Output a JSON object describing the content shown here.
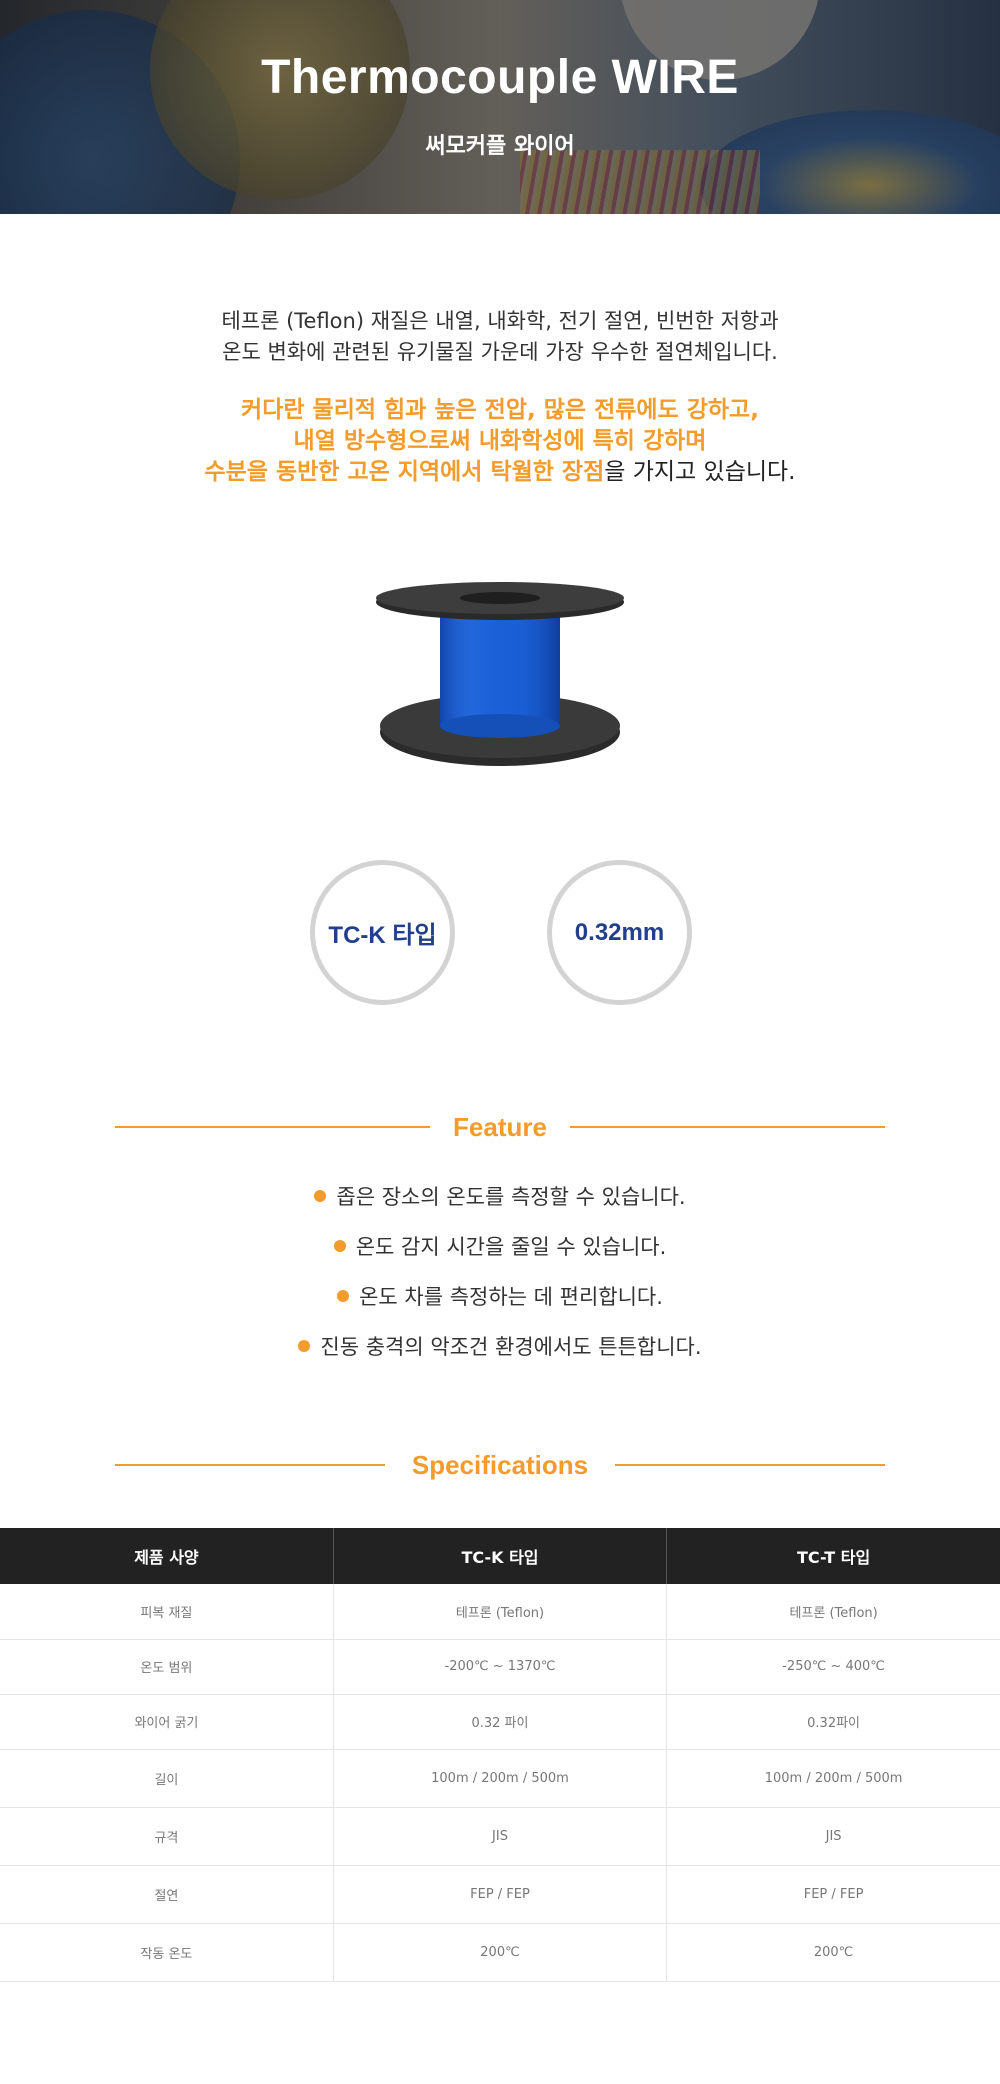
{
  "hero": {
    "title": "Thermocouple WIRE",
    "subtitle": "써모커플 와이어"
  },
  "intro": {
    "line1": "테프론 (Teflon) 재질은 내열, 내화학, 전기 절연, 빈번한 저항과",
    "line2": "온도 변화에 관련된 유기물질 가운데 가장 우수한 절연체입니다."
  },
  "highlight": {
    "line1": "커다란 물리적 힘과 높은 전압, 많은 전류에도 강하고,",
    "line2": "내열 방수형으로써 내화학성에 특히 강하며",
    "line3_orange": "수분을 동반한 고온 지역에서 탁월한 장점",
    "line3_rest": "을 가지고 있습니다."
  },
  "badges": {
    "type": "TC-K 타입",
    "size": "0.32mm"
  },
  "feature": {
    "heading": "Feature",
    "items": [
      "좁은 장소의 온도를 측정할 수 있습니다.",
      "온도 감지 시간을 줄일 수 있습니다.",
      "온도 차를 측정하는 데 편리합니다.",
      "진동 충격의 악조건 환경에서도 튼튼합니다."
    ]
  },
  "specifications": {
    "heading": "Specifications",
    "headers": [
      "제품 사양",
      "TC-K 타입",
      "TC-T 타입"
    ],
    "rows": [
      [
        "피복 재질",
        "테프론 (Teflon)",
        "테프론 (Teflon)"
      ],
      [
        "온도 범위",
        "-200℃ ~ 1370℃",
        "-250℃ ~ 400℃"
      ],
      [
        "와이어 굵기",
        "0.32 파이",
        "0.32파이"
      ],
      [
        "길이",
        "100m / 200m / 500m",
        "100m / 200m / 500m"
      ],
      [
        "규격",
        "JIS",
        "JIS"
      ],
      [
        "절연",
        "FEP / FEP",
        "FEP / FEP"
      ],
      [
        "작동 온도",
        "200℃",
        "200℃"
      ]
    ]
  },
  "colors": {
    "accent": "#f39c2b",
    "badge_text": "#223f8d",
    "table_header_bg": "#222222",
    "wire_blue": "#1a5fd6"
  }
}
